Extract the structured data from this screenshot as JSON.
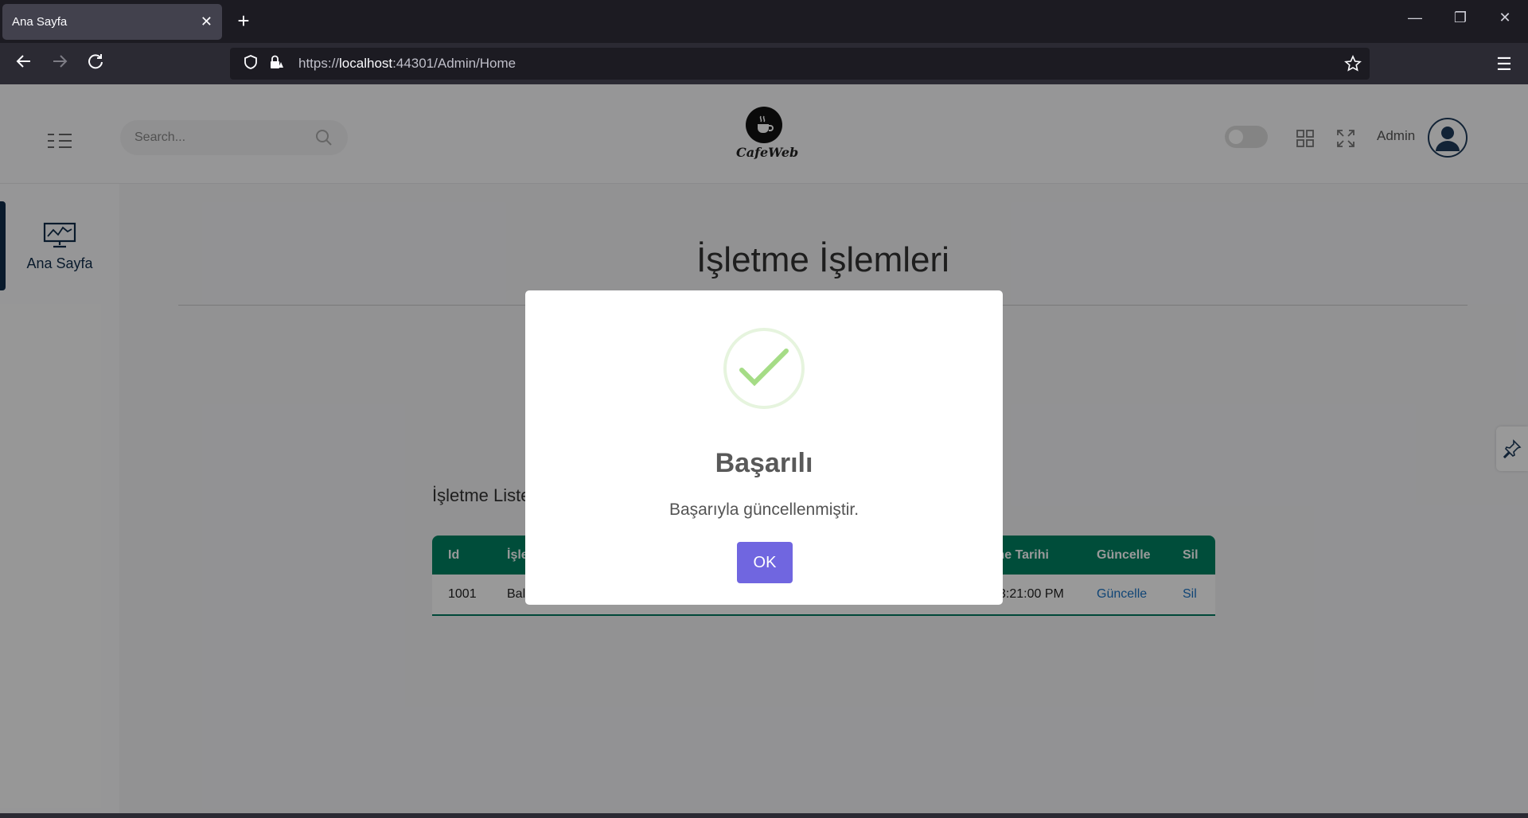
{
  "browser": {
    "tab_title": "Ana Sayfa",
    "url_prefix": "https://",
    "url_host": "localhost",
    "url_rest": ":44301/Admin/Home"
  },
  "header": {
    "search_placeholder": "Search...",
    "brand": "CafeWeb",
    "admin_name": "Admin"
  },
  "sidebar": {
    "items": [
      {
        "label": "Ana Sayfa"
      }
    ]
  },
  "main": {
    "title": "İşletme İşlemleri",
    "list_title": "İşletme Liste",
    "table": {
      "headers": [
        "Id",
        "İşle",
        "me Tarihi",
        "Güncelle",
        "Sil"
      ],
      "rows": [
        {
          "id": "1001",
          "name": "Bal",
          "date": "3:21:00 PM",
          "update": "Güncelle",
          "delete": "Sil"
        }
      ]
    }
  },
  "modal": {
    "title": "Başarılı",
    "message": "Başarıyla güncellenmiştir.",
    "ok_label": "OK"
  },
  "colors": {
    "accent": "#7066e0",
    "table_header": "#008162",
    "success": "#a5dc86"
  }
}
